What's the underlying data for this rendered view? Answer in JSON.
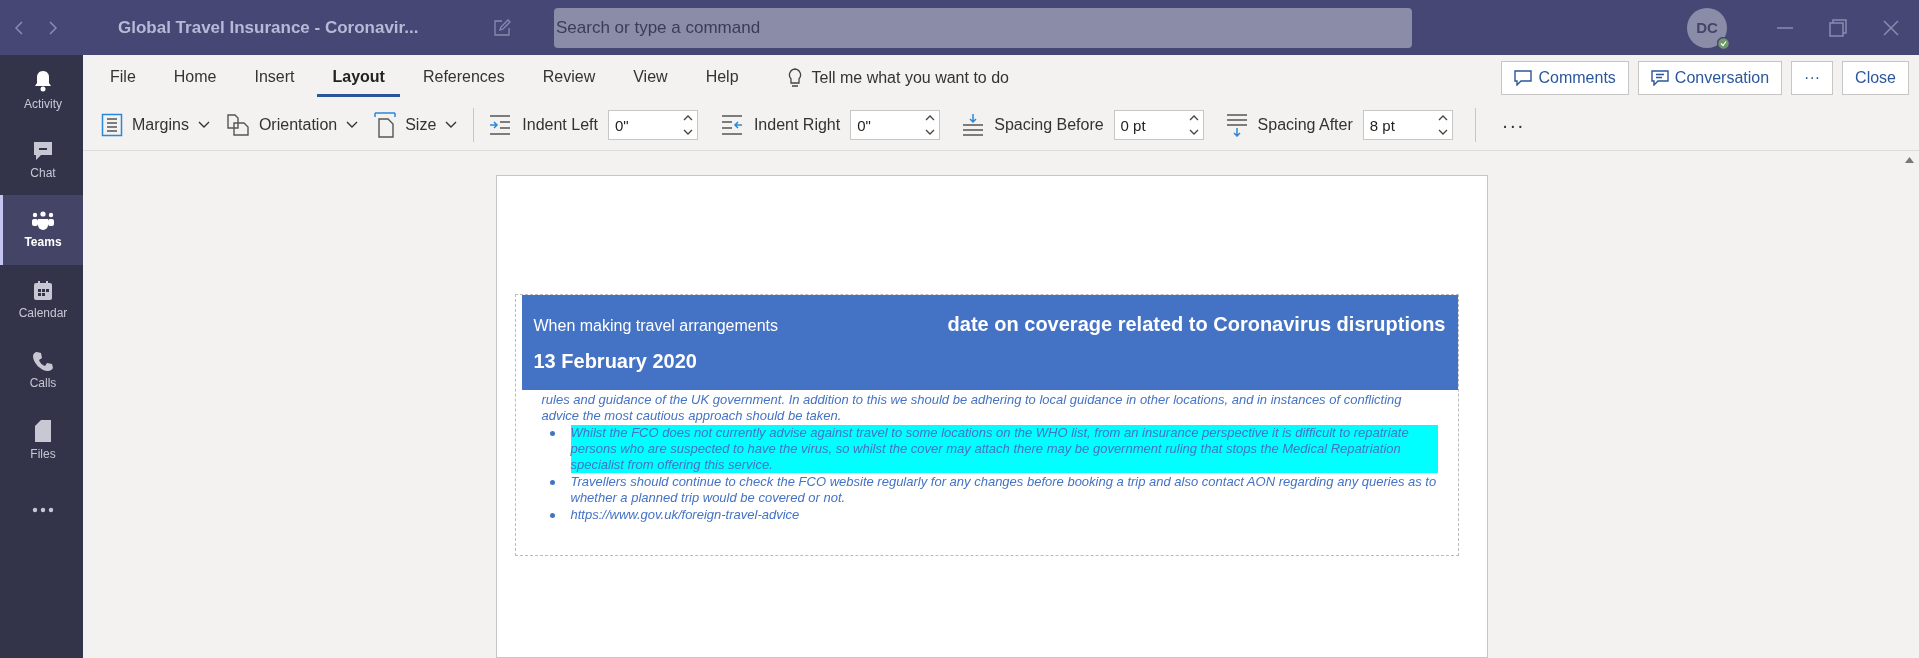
{
  "window": {
    "title": "Global Travel Insurance - Coronavir...",
    "search_placeholder": "Search or type a command",
    "avatar_initials": "DC"
  },
  "rail": [
    {
      "kind": "app",
      "label": "Activity",
      "selected": false
    },
    {
      "kind": "app",
      "label": "Chat",
      "selected": false
    },
    {
      "kind": "app",
      "label": "Teams",
      "selected": true
    },
    {
      "kind": "app",
      "label": "Calendar",
      "selected": false
    },
    {
      "kind": "app",
      "label": "Calls",
      "selected": false
    },
    {
      "kind": "app",
      "label": "Files",
      "selected": false
    },
    {
      "kind": "more",
      "selected": false
    }
  ],
  "menu_tabs": [
    {
      "label": "File",
      "selected": false
    },
    {
      "label": "Home",
      "selected": false
    },
    {
      "label": "Insert",
      "selected": false
    },
    {
      "label": "Layout",
      "selected": true
    },
    {
      "label": "References",
      "selected": false
    },
    {
      "label": "Review",
      "selected": false
    },
    {
      "label": "View",
      "selected": false
    },
    {
      "label": "Help",
      "selected": false
    }
  ],
  "tell_me": "Tell me what you want to do",
  "actions": [
    {
      "label": "Comments"
    },
    {
      "label": "Conversation"
    },
    {
      "label": "···"
    },
    {
      "label": "Close"
    }
  ],
  "ribbon": [
    {
      "kind": "dropdown",
      "label": "Margins"
    },
    {
      "kind": "dropdown",
      "label": "Orientation"
    },
    {
      "kind": "dropdown",
      "label": "Size"
    },
    {
      "kind": "separator"
    },
    {
      "kind": "spinner",
      "label": "Indent Left",
      "value": "0\""
    },
    {
      "kind": "spinner",
      "label": "Indent Right",
      "value": "0\""
    },
    {
      "kind": "spinner",
      "label": "Spacing Before",
      "value": "0 pt"
    },
    {
      "kind": "spinner",
      "label": "Spacing After",
      "value": "8 pt"
    },
    {
      "kind": "separator"
    },
    {
      "kind": "more",
      "label": "···"
    }
  ],
  "document": {
    "banner_overlay": "When making travel arrangements",
    "banner_title": "date on coverage related to Coronavirus disruptions",
    "banner_date": "13 February 2020",
    "paragraphs": [
      {
        "kind": "plain",
        "highlighted": false,
        "text": "rules and guidance of the UK government. In addition to this we should be adhering to local guidance in other locations, and in instances of conflicting advice the most cautious approach should be taken."
      },
      {
        "kind": "bullet",
        "highlighted": true,
        "text": "Whilst the FCO does not currently advise against travel to some locations on the WHO list, from an insurance perspective it is difficult to repatriate persons who are suspected to have the virus, so whilst the cover may attach there may be government ruling that stops the Medical Repatriation specialist from offering this service."
      },
      {
        "kind": "bullet",
        "highlighted": false,
        "text": "Travellers should continue to check the FCO website regularly for any changes before booking a trip and also contact AON regarding any queries as to whether a planned trip would be covered or not."
      },
      {
        "kind": "bullet",
        "highlighted": false,
        "text": "https://www.gov.uk/foreign-travel-advice"
      }
    ]
  }
}
